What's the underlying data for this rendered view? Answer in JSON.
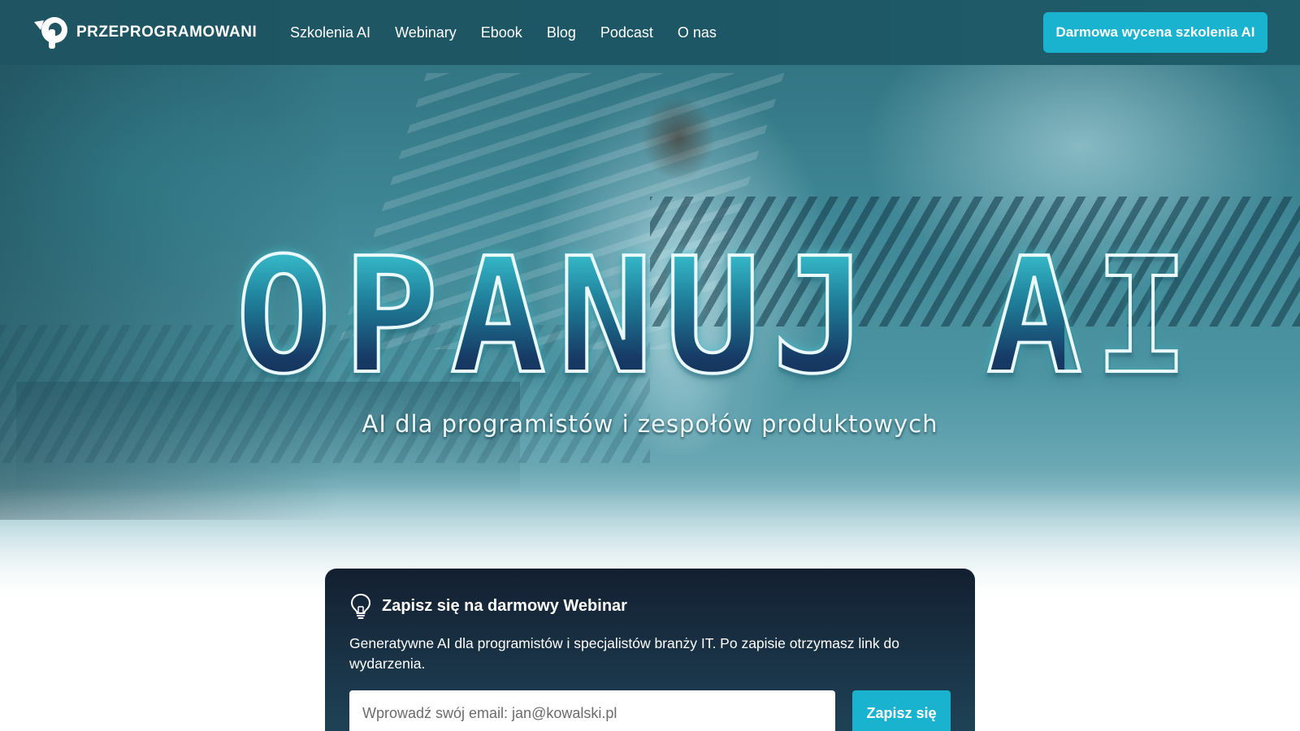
{
  "brand": {
    "name": "PRZEPROGRAMOWANI",
    "accent_color": "#1ab3cf",
    "navbar_color": "#1f5563"
  },
  "nav": {
    "links": [
      {
        "label": "Szkolenia AI"
      },
      {
        "label": "Webinary"
      },
      {
        "label": "Ebook"
      },
      {
        "label": "Blog"
      },
      {
        "label": "Podcast"
      },
      {
        "label": "O nas"
      }
    ],
    "cta_label": "Darmowa wycena szkolenia AI"
  },
  "hero": {
    "headline": "OPANUJ AI",
    "subheadline": "AI dla programistów i zespołów produktowych"
  },
  "webinar": {
    "icon": "lightbulb-icon",
    "title": "Zapisz się na darmowy Webinar",
    "description": "Generatywne AI dla programistów i specjalistów branży IT. Po zapisie otrzymasz link do wydarzenia.",
    "email_placeholder": "Wprowadź swój email: jan@kowalski.pl",
    "email_value": "",
    "submit_label": "Zapisz się"
  }
}
